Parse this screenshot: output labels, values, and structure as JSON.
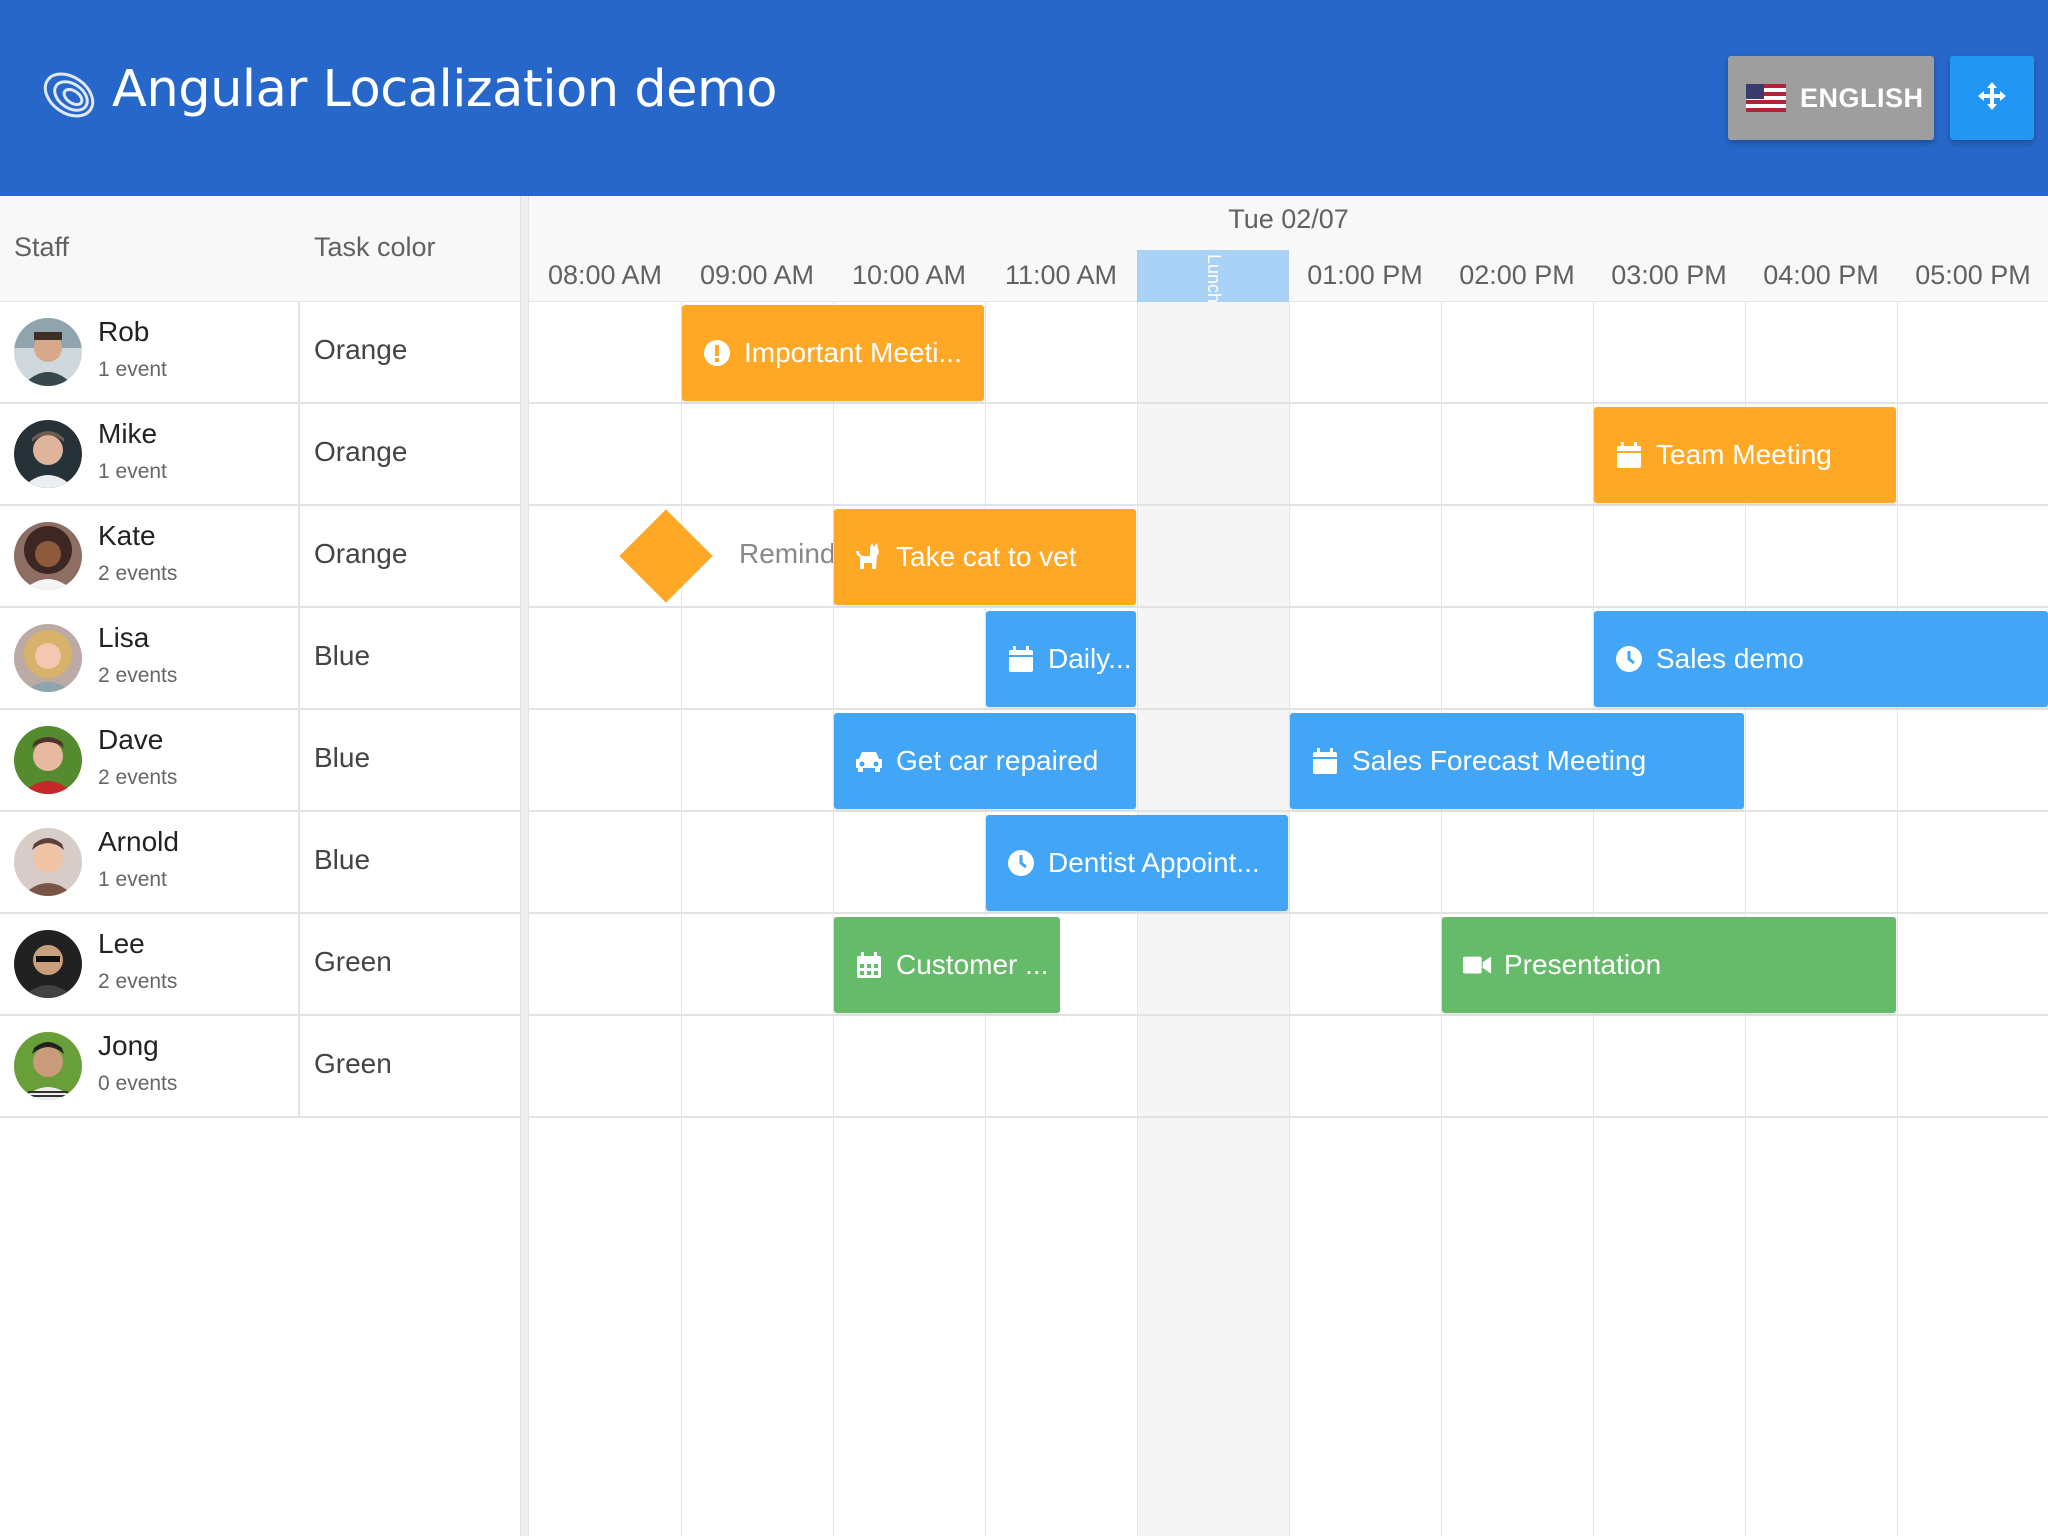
{
  "header": {
    "title": "Angular Localization demo",
    "language_label": "ENGLISH",
    "background": "#2767c9"
  },
  "grid": {
    "columns": [
      "Staff",
      "Task color"
    ],
    "rows": [
      {
        "name": "Rob",
        "events": "1 event",
        "color": "Orange"
      },
      {
        "name": "Mike",
        "events": "1 event",
        "color": "Orange"
      },
      {
        "name": "Kate",
        "events": "2 events",
        "color": "Orange"
      },
      {
        "name": "Lisa",
        "events": "2 events",
        "color": "Blue"
      },
      {
        "name": "Dave",
        "events": "2 events",
        "color": "Blue"
      },
      {
        "name": "Arnold",
        "events": "1 event",
        "color": "Blue"
      },
      {
        "name": "Lee",
        "events": "2 events",
        "color": "Green"
      },
      {
        "name": "Jong",
        "events": "0 events",
        "color": "Green"
      }
    ]
  },
  "timeline": {
    "date": "Tue 02/07",
    "hours": [
      "08:00 AM",
      "09:00 AM",
      "10:00 AM",
      "11:00 AM",
      "",
      "01:00 PM",
      "02:00 PM",
      "03:00 PM",
      "04:00 PM",
      "05:00 PM"
    ],
    "lunch_label": "Lunch",
    "events": [
      {
        "id": "ev-rob",
        "label": "Important Meeti...",
        "icon": "exclamation-circle-icon",
        "color": "orange"
      },
      {
        "id": "ev-mike",
        "label": "Team Meeting",
        "icon": "calendar-icon",
        "color": "orange"
      },
      {
        "id": "ev-kate-ms",
        "label": "Remind",
        "icon": "milestone-diamond-icon",
        "color": "orange"
      },
      {
        "id": "ev-kate",
        "label": "Take cat to vet",
        "icon": "cat-icon",
        "color": "orange"
      },
      {
        "id": "ev-lisa-1",
        "label": "Daily...",
        "icon": "calendar-icon",
        "color": "blue"
      },
      {
        "id": "ev-lisa-2",
        "label": "Sales demo",
        "icon": "clock-icon",
        "color": "blue"
      },
      {
        "id": "ev-dave-1",
        "label": "Get car repaired",
        "icon": "car-icon",
        "color": "blue"
      },
      {
        "id": "ev-dave-2",
        "label": "Sales Forecast Meeting",
        "icon": "calendar-icon",
        "color": "blue"
      },
      {
        "id": "ev-arnold",
        "label": "Dentist Appoint...",
        "icon": "clock-icon",
        "color": "blue"
      },
      {
        "id": "ev-lee-1",
        "label": "Customer ...",
        "icon": "calendar-grid-icon",
        "color": "green"
      },
      {
        "id": "ev-lee-2",
        "label": "Presentation",
        "icon": "video-icon",
        "color": "green"
      }
    ]
  },
  "colors": {
    "orange": "#ffa826",
    "blue": "#42a5f5",
    "green": "#66bb6a",
    "accent": "#2196f3"
  }
}
